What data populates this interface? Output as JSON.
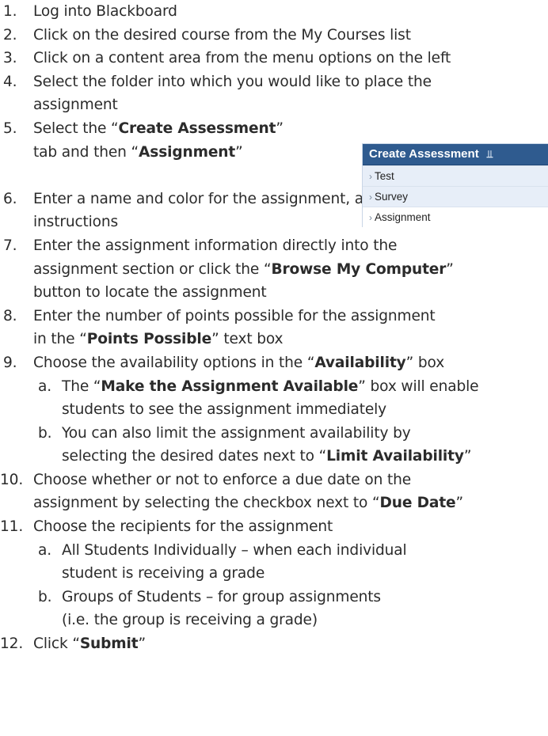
{
  "steps": [
    {
      "num": "1.",
      "text": "Log into Blackboard"
    },
    {
      "num": "2.",
      "text": "Click on the desired course from the My Courses list"
    },
    {
      "num": "3.",
      "text": "Click on a content area from the menu options on the left"
    },
    {
      "num": "4.",
      "line1": "Select the folder into which you would like to place the",
      "line2": "assignment"
    },
    {
      "num": "5.",
      "pre": "Select the “",
      "bold1": "Create Assessment",
      "mid": "”",
      "line2_pre": "tab and then “",
      "bold2": "Assignment",
      "line2_post": "”"
    },
    {
      "num": "6.",
      "line1": "Enter a name and color for the assignment, as well as",
      "line2": "instructions"
    },
    {
      "num": "7.",
      "line1": "Enter the assignment information directly into the",
      "line2_pre": "assignment section or click the “",
      "bold": "Browse My Computer",
      "line2_post": "”",
      "line3": "button to locate the assignment"
    },
    {
      "num": "8.",
      "line1": "Enter the number of points possible for the assignment",
      "line2_pre": "in the “",
      "bold": "Points Possible",
      "line2_post": "” text box"
    },
    {
      "num": "9.",
      "pre": "Choose the availability options in the “",
      "bold": "Availability",
      "post": "” box"
    },
    {
      "num": "10.",
      "line1_pre": "Choose whether or not to enforce a due date on the",
      "line2_pre": "assignment by selecting the checkbox next to “",
      "bold": "Due Date",
      "line2_post": "”"
    },
    {
      "num": "11.",
      "text": "Choose the recipients for the assignment"
    },
    {
      "num": "12.",
      "pre": "Click “",
      "bold": "Submit",
      "post": "”"
    }
  ],
  "sub9": [
    {
      "num": "a.",
      "pre": "The “",
      "bold": "Make the Assignment Available",
      "post": "” box will enable",
      "line2": "students to see the assignment immediately"
    },
    {
      "num": "b.",
      "line1": "You can also limit the assignment availability by",
      "line2_pre": "selecting the desired dates next to “",
      "bold": "Limit Availability",
      "line2_post": "”"
    }
  ],
  "sub11": [
    {
      "num": "a.",
      "line1": "All Students Individually – when each individual",
      "line2": "student is receiving a grade"
    },
    {
      "num": "b.",
      "line1": "Groups of Students – for group assignments",
      "line2": "(i.e. the group is receiving a grade)"
    }
  ],
  "menu": {
    "header": "Create Assessment",
    "header_icon": "double-chevron-down-icon",
    "items": [
      "Test",
      "Survey",
      "Assignment"
    ],
    "active_item": "Assignment",
    "colors": {
      "header_bg": "#2f5b8f",
      "item_bg": "#e7eef8"
    }
  }
}
